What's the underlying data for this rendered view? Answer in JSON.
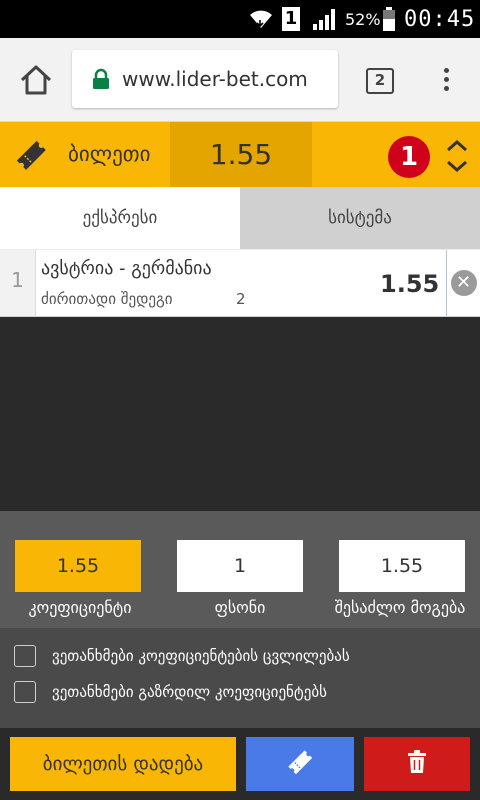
{
  "status_bar": {
    "sim_slot": "1",
    "battery_percent": "52%",
    "time": "00:45",
    "icons": [
      "wifi-icon",
      "sim-icon",
      "signal-icon",
      "battery-icon"
    ]
  },
  "browser": {
    "url": "www.lider-bet.com",
    "tab_count": "2",
    "icons": [
      "home-icon",
      "lock-icon",
      "tabs-icon",
      "more-vert-icon"
    ]
  },
  "ticket": {
    "title": "ბილეთი",
    "total_odds": "1.55",
    "bet_count": "1",
    "icons": [
      "ticket-icon",
      "expand-toggle-icon"
    ]
  },
  "tabs": [
    {
      "label": "ექსპრესი",
      "active": true
    },
    {
      "label": "სისტემა",
      "active": false
    }
  ],
  "bets": [
    {
      "index": "1",
      "match": "ავსტრია - გერმანია",
      "market": "ძირითადი შედეგი",
      "outcome": "2",
      "odds": "1.55"
    }
  ],
  "summary": {
    "coefficient_value": "1.55",
    "coefficient_label": "კოეფიციენტი",
    "stake_value": "1",
    "stake_label": "ფსონი",
    "possible_win_value": "1.55",
    "possible_win_label": "შესაძლო მოგება"
  },
  "agreements": [
    {
      "label": "ვეთანხმები კოეფიციენტების ცვლილებას",
      "checked": false
    },
    {
      "label": "ვეთანხმები გაზრდილ კოეფიციენტებს",
      "checked": false
    }
  ],
  "actions": {
    "place_bet_label": "ბილეთის დადება",
    "icons": [
      "ticket-icon",
      "trash-icon"
    ]
  },
  "colors": {
    "accent_yellow": "#f9b604",
    "accent_yellow_dark": "#e5a500",
    "badge_red": "#d0021b",
    "button_blue": "#4a7ae8",
    "button_red": "#d01b1b"
  }
}
